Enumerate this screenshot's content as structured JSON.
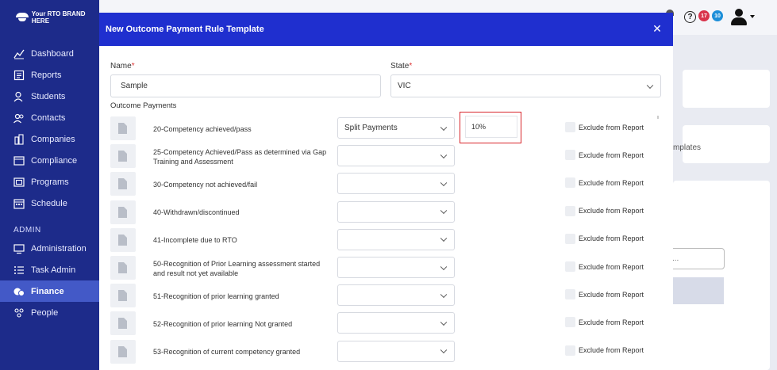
{
  "brand": {
    "name": "Your RTO BRAND HERE"
  },
  "sidebar": {
    "items": [
      {
        "label": "Dashboard",
        "icon": "chart-line-icon"
      },
      {
        "label": "Reports",
        "icon": "report-icon"
      },
      {
        "label": "Students",
        "icon": "students-icon"
      },
      {
        "label": "Contacts",
        "icon": "contacts-icon"
      },
      {
        "label": "Companies",
        "icon": "companies-icon"
      },
      {
        "label": "Compliance",
        "icon": "compliance-icon"
      },
      {
        "label": "Programs",
        "icon": "programs-icon"
      },
      {
        "label": "Schedule",
        "icon": "calendar-icon"
      }
    ],
    "section_admin": "ADMIN",
    "admin_items": [
      {
        "label": "Administration",
        "icon": "monitor-icon"
      },
      {
        "label": "Task Admin",
        "icon": "list-icon"
      },
      {
        "label": "Finance",
        "icon": "finance-icon",
        "active": true
      },
      {
        "label": "People",
        "icon": "people-icon"
      }
    ]
  },
  "topbar": {
    "help": "?",
    "notifications_red": "17",
    "notifications_blue": "10"
  },
  "background": {
    "templates_text": "mplates",
    "search_placeholder": "..."
  },
  "modal": {
    "title": "New Outcome Payment Rule Template",
    "close": "✕",
    "name_label": "Name",
    "name_value": "Sample",
    "state_label": "State",
    "state_value": "VIC",
    "outcome_payments_label": "Outcome Payments",
    "exclude_label": "Exclude from Report",
    "rows": [
      {
        "label": "20-Competency achieved/pass",
        "select": "Split Payments",
        "pct": "10%"
      },
      {
        "label": "25-Competency Achieved/Pass as determined via Gap Training and Assessment",
        "select": ""
      },
      {
        "label": "30-Competency not achieved/fail",
        "select": ""
      },
      {
        "label": "40-Withdrawn/discontinued",
        "select": ""
      },
      {
        "label": "41-Incomplete due to RTO",
        "select": ""
      },
      {
        "label": "50-Recognition of Prior Learning assessment started and result not yet available",
        "select": ""
      },
      {
        "label": "51-Recognition of prior learning granted",
        "select": ""
      },
      {
        "label": "52-Recognition of prior learning Not granted",
        "select": ""
      },
      {
        "label": "53-Recognition of current competency granted",
        "select": ""
      }
    ]
  },
  "colors": {
    "sidebar": "#1d2b8a",
    "active": "#4359c7",
    "modal_header": "#1f2fcf",
    "highlight": "#d8252b"
  }
}
